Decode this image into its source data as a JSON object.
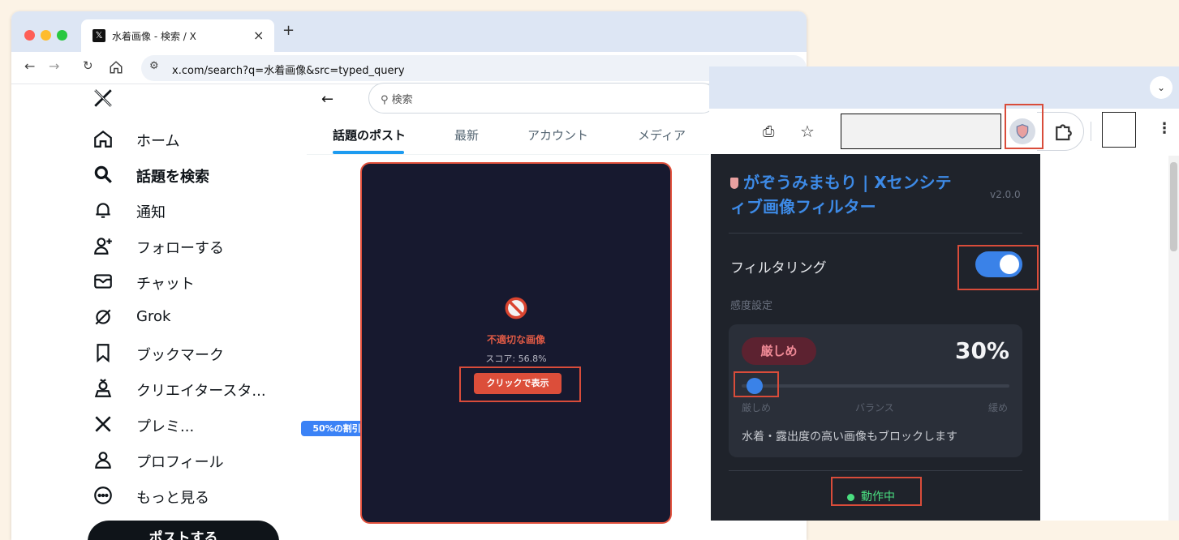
{
  "browser1": {
    "tab_title": "水着画像 - 検索 / X",
    "tab_close": "×",
    "new_tab": "+",
    "url": "x.com/search?q=水着画像&src=typed_query"
  },
  "nav": {
    "items": [
      {
        "label": "ホーム"
      },
      {
        "label": "話題を検索"
      },
      {
        "label": "通知"
      },
      {
        "label": "フォローする"
      },
      {
        "label": "チャット"
      },
      {
        "label": "Grok"
      },
      {
        "label": "ブックマーク"
      },
      {
        "label": "クリエイタースタ..."
      },
      {
        "label": "プレミ..."
      },
      {
        "label": "プロフィール"
      },
      {
        "label": "もっと見る"
      }
    ],
    "premium_badge": "50%の割引",
    "post_button": "ポストする"
  },
  "search": {
    "placeholder": "検索",
    "tabs": [
      "話題のポスト",
      "最新",
      "アカウント",
      "メディア"
    ]
  },
  "filtered_image": {
    "title": "不適切な画像",
    "score": "スコア: 56.8%",
    "button": "クリックで表示"
  },
  "extension": {
    "title": "がぞうみまもり | Xセンシティブ画像フィルター",
    "version": "v2.0.0",
    "filter_label": "フィルタリング",
    "filter_on": true,
    "sensitivity_label": "感度設定",
    "level_badge": "厳しめ",
    "percent": "30%",
    "slider_value": 0.0,
    "ticks": [
      "厳しめ",
      "バランス",
      "緩め"
    ],
    "description": "水着・露出度の高い画像もブロックします",
    "status": "動作中"
  },
  "colors": {
    "accent_blue": "#3a82e8",
    "highlight_red": "#d94c3a",
    "status_green": "#4ade80"
  }
}
